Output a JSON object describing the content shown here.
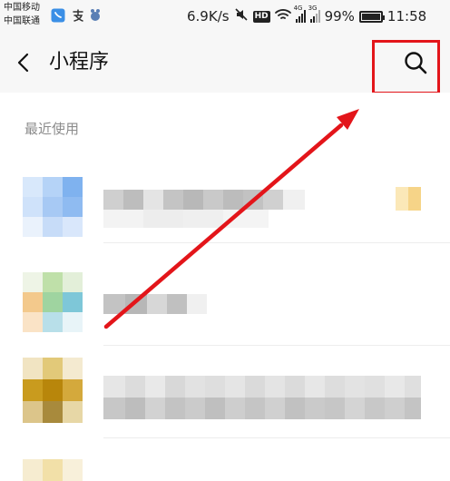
{
  "status_bar": {
    "carrier_1": "中国移动",
    "carrier_2": "中国联通",
    "net_speed": "6.9K/s",
    "hd_label": "HD",
    "signal_1_tag": "4G",
    "signal_2_tag": "3G",
    "battery_percent": "99%",
    "battery_level": 0.99,
    "time": "11:58",
    "icons": [
      "hd-call-icon",
      "alipay-icon",
      "app-notification-icon",
      "mute-icon",
      "wifi-icon",
      "signal-icon",
      "battery-icon"
    ]
  },
  "header": {
    "back_icon": "chevron-left-icon",
    "title": "小程序",
    "search_icon": "search-icon",
    "highlight_color": "#e3151a"
  },
  "section": {
    "recent_label": "最近使用"
  },
  "colors": {
    "accent_red": "#e3151a",
    "header_bg": "#f7f7f7",
    "label_gray": "#8c8c8c"
  }
}
